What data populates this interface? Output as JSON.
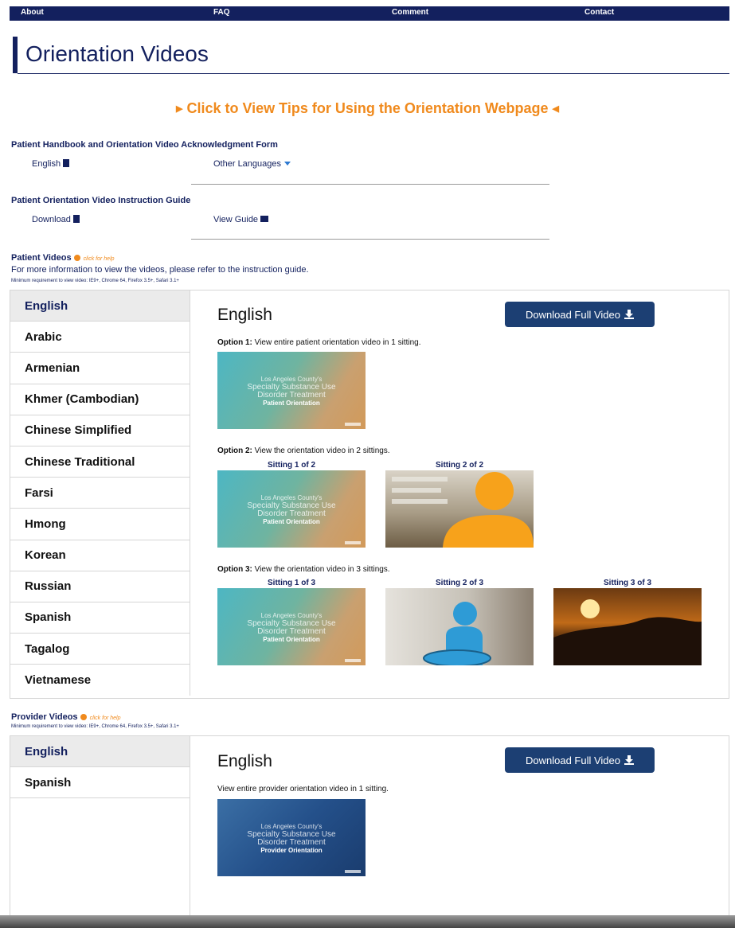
{
  "nav": {
    "items": [
      "About",
      "FAQ",
      "Comment",
      "Contact"
    ]
  },
  "page_title": "Orientation Videos",
  "tips_link": "Click to View Tips for Using the Orientation Webpage",
  "ack_form": {
    "heading": "Patient Handbook and Orientation Video Acknowledgment Form",
    "english": "English",
    "other_languages": "Other Languages"
  },
  "instruction_guide": {
    "heading": "Patient Orientation Video Instruction Guide",
    "download": "Download",
    "view_guide": "View Guide"
  },
  "patient_videos": {
    "heading": "Patient Videos",
    "help": "click for help",
    "info": "For more information to view the videos, please refer to the instruction guide.",
    "requirement": "Minimum requirement to view video: IE9+, Chrome 64, Firefox 3.5+, Safari 3.1+",
    "languages": [
      "English",
      "Arabic",
      "Armenian",
      "Khmer (Cambodian)",
      "Chinese Simplified",
      "Chinese Traditional",
      "Farsi",
      "Hmong",
      "Korean",
      "Russian",
      "Spanish",
      "Tagalog",
      "Vietnamese"
    ],
    "selected": "English",
    "download_btn": "Download Full Video",
    "option1": {
      "label": "Option 1:",
      "text": "View entire patient orientation video in 1 sitting."
    },
    "option2": {
      "label": "Option 2:",
      "text": "View the orientation video in 2 sittings.",
      "sittings": [
        "Sitting 1 of 2",
        "Sitting 2 of 2"
      ]
    },
    "option3": {
      "label": "Option 3:",
      "text": "View the orientation video in 3 sittings.",
      "sittings": [
        "Sitting 1 of 3",
        "Sitting 2 of 3",
        "Sitting 3 of 3"
      ]
    }
  },
  "thumb_text": {
    "line1": "Los Angeles County's",
    "line2": "Specialty Substance Use",
    "line3": "Disorder Treatment",
    "patient": "Patient Orientation",
    "provider": "Provider Orientation"
  },
  "provider_videos": {
    "heading": "Provider Videos",
    "help": "click for help",
    "requirement": "Minimum requirement to view video: IE9+, Chrome 64, Firefox 3.5+, Safari 3.1+",
    "languages": [
      "English",
      "Spanish"
    ],
    "selected": "English",
    "download_btn": "Download Full Video",
    "text": "View entire provider orientation video in 1 sitting."
  },
  "colors": {
    "navy": "#13205e",
    "orange": "#f08a1d",
    "button": "#1c3f73"
  }
}
